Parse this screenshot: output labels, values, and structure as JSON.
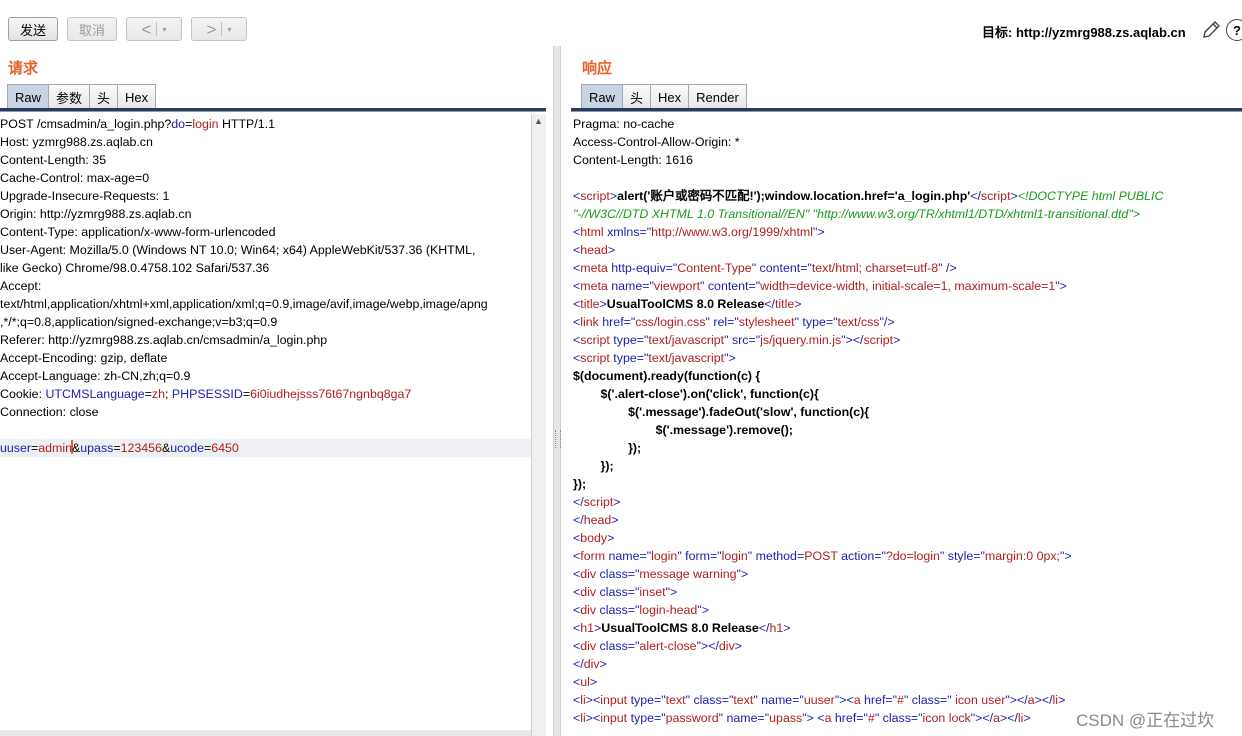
{
  "toolbar": {
    "send_label": "发送",
    "cancel_label": "取消",
    "back_glyph": "<",
    "forward_glyph": ">",
    "dropdown_glyph": "▾"
  },
  "target": {
    "text": "目标: http://yzmrg988.zs.aqlab.cn"
  },
  "icons": {
    "edit": "pencil-icon",
    "help": "help-icon",
    "help_glyph": "?"
  },
  "request": {
    "title": "请求",
    "tabs": [
      "Raw",
      "参数",
      "头",
      "Hex"
    ],
    "active_tab": "Raw",
    "lines": [
      [
        {
          "t": "POST /cmsadmin/a_login.php?"
        },
        {
          "t": "do",
          "c": "p"
        },
        {
          "t": "="
        },
        {
          "t": "login",
          "c": "v"
        },
        {
          "t": " HTTP/1.1"
        }
      ],
      [
        {
          "t": "Host: yzmrg988.zs.aqlab.cn"
        }
      ],
      [
        {
          "t": "Content-Length: 35"
        }
      ],
      [
        {
          "t": "Cache-Control: max-age=0"
        }
      ],
      [
        {
          "t": "Upgrade-Insecure-Requests: 1"
        }
      ],
      [
        {
          "t": "Origin: http://yzmrg988.zs.aqlab.cn"
        }
      ],
      [
        {
          "t": "Content-Type: application/x-www-form-urlencoded"
        }
      ],
      [
        {
          "t": "User-Agent: Mozilla/5.0 (Windows NT 10.0; Win64; x64) AppleWebKit/537.36 (KHTML,"
        }
      ],
      [
        {
          "t": "like Gecko) Chrome/98.0.4758.102 Safari/537.36"
        }
      ],
      [
        {
          "t": "Accept:"
        }
      ],
      [
        {
          "t": "text/html,application/xhtml+xml,application/xml;q=0.9,image/avif,image/webp,image/apng"
        }
      ],
      [
        {
          "t": ",*/*;q=0.8,application/signed-exchange;v=b3;q=0.9"
        }
      ],
      [
        {
          "t": "Referer: http://yzmrg988.zs.aqlab.cn/cmsadmin/a_login.php"
        }
      ],
      [
        {
          "t": "Accept-Encoding: gzip, deflate"
        }
      ],
      [
        {
          "t": "Accept-Language: zh-CN,zh;q=0.9"
        }
      ],
      [
        {
          "t": "Cookie: "
        },
        {
          "t": "UTCMSLanguage",
          "c": "p"
        },
        {
          "t": "="
        },
        {
          "t": "zh",
          "c": "v"
        },
        {
          "t": "; "
        },
        {
          "t": "PHPSESSID",
          "c": "p"
        },
        {
          "t": "="
        },
        {
          "t": "6i0iudhejsss76t67ngnbq8ga7",
          "c": "v"
        }
      ],
      [
        {
          "t": "Connection: close"
        }
      ],
      [
        {
          "t": ""
        }
      ],
      [
        {
          "t": "uuser",
          "c": "p"
        },
        {
          "t": "="
        },
        {
          "t": "admin",
          "c": "v"
        },
        {
          "caret": true
        },
        {
          "t": "&"
        },
        {
          "t": "upass",
          "c": "p"
        },
        {
          "t": "="
        },
        {
          "t": "123456",
          "c": "v"
        },
        {
          "t": "&"
        },
        {
          "t": "ucode",
          "c": "p"
        },
        {
          "t": "="
        },
        {
          "t": "6450",
          "c": "v"
        }
      ]
    ],
    "highlight_line": 18
  },
  "response": {
    "title": "响应",
    "tabs": [
      "Raw",
      "头",
      "Hex",
      "Render"
    ],
    "active_tab": "Raw",
    "lines": [
      [
        {
          "t": "Pragma: no-cache"
        }
      ],
      [
        {
          "t": "Access-Control-Allow-Origin: *"
        }
      ],
      [
        {
          "t": "Content-Length: 1616"
        }
      ],
      [
        {
          "t": ""
        }
      ],
      [
        {
          "t": "<",
          "c": "p"
        },
        {
          "t": "script",
          "c": "v"
        },
        {
          "t": ">",
          "c": "p"
        },
        {
          "t": "alert('账户或密码不匹配!');window.location.href='a_login.php'",
          "c": "b"
        },
        {
          "t": "</",
          "c": "p"
        },
        {
          "t": "script",
          "c": "v"
        },
        {
          "t": ">",
          "c": "p"
        },
        {
          "t": "<!DOCTYPE html PUBLIC",
          "c": "g"
        }
      ],
      [
        {
          "t": "\"-//W3C//DTD XHTML 1.0 Transitional//EN\" \"http://www.w3.org/TR/xhtml1/DTD/xhtml1-transitional.dtd\">",
          "c": "g"
        }
      ],
      [
        {
          "t": "<",
          "c": "p"
        },
        {
          "t": "html",
          "c": "v"
        },
        {
          "t": " xmlns",
          "c": "p"
        },
        {
          "t": "=\"",
          "c": "p"
        },
        {
          "t": "http://www.w3.org/1999/xhtml",
          "c": "v"
        },
        {
          "t": "\">",
          "c": "p"
        }
      ],
      [
        {
          "t": "<",
          "c": "p"
        },
        {
          "t": "head",
          "c": "v"
        },
        {
          "t": ">",
          "c": "p"
        }
      ],
      [
        {
          "t": "<",
          "c": "p"
        },
        {
          "t": "meta",
          "c": "v"
        },
        {
          "t": " http-equiv",
          "c": "p"
        },
        {
          "t": "=\"",
          "c": "p"
        },
        {
          "t": "Content-Type",
          "c": "v"
        },
        {
          "t": "\" content",
          "c": "p"
        },
        {
          "t": "=\"",
          "c": "p"
        },
        {
          "t": "text/html; charset=utf-8",
          "c": "v"
        },
        {
          "t": "\" />",
          "c": "p"
        }
      ],
      [
        {
          "t": "<",
          "c": "p"
        },
        {
          "t": "meta",
          "c": "v"
        },
        {
          "t": " name",
          "c": "p"
        },
        {
          "t": "=\"",
          "c": "p"
        },
        {
          "t": "viewport",
          "c": "v"
        },
        {
          "t": "\" content",
          "c": "p"
        },
        {
          "t": "=\"",
          "c": "p"
        },
        {
          "t": "width=device-width, initial-scale=1, maximum-scale=1",
          "c": "v"
        },
        {
          "t": "\">",
          "c": "p"
        }
      ],
      [
        {
          "t": "<",
          "c": "p"
        },
        {
          "t": "title",
          "c": "v"
        },
        {
          "t": ">",
          "c": "p"
        },
        {
          "t": "UsualToolCMS 8.0 Release",
          "c": "b"
        },
        {
          "t": "</",
          "c": "p"
        },
        {
          "t": "title",
          "c": "v"
        },
        {
          "t": ">",
          "c": "p"
        }
      ],
      [
        {
          "t": "<",
          "c": "p"
        },
        {
          "t": "link",
          "c": "v"
        },
        {
          "t": " href",
          "c": "p"
        },
        {
          "t": "=\"",
          "c": "p"
        },
        {
          "t": "css/login.css",
          "c": "v"
        },
        {
          "t": "\" rel",
          "c": "p"
        },
        {
          "t": "=\"",
          "c": "p"
        },
        {
          "t": "stylesheet",
          "c": "v"
        },
        {
          "t": "\" type",
          "c": "p"
        },
        {
          "t": "=\"",
          "c": "p"
        },
        {
          "t": "text/css",
          "c": "v"
        },
        {
          "t": "\"/>",
          "c": "p"
        }
      ],
      [
        {
          "t": "<",
          "c": "p"
        },
        {
          "t": "script",
          "c": "v"
        },
        {
          "t": " type",
          "c": "p"
        },
        {
          "t": "=\"",
          "c": "p"
        },
        {
          "t": "text/javascript",
          "c": "v"
        },
        {
          "t": "\" src",
          "c": "p"
        },
        {
          "t": "=\"",
          "c": "p"
        },
        {
          "t": "js/jquery.min.js",
          "c": "v"
        },
        {
          "t": "\"></",
          "c": "p"
        },
        {
          "t": "script",
          "c": "v"
        },
        {
          "t": ">",
          "c": "p"
        }
      ],
      [
        {
          "t": "<",
          "c": "p"
        },
        {
          "t": "script",
          "c": "v"
        },
        {
          "t": " type",
          "c": "p"
        },
        {
          "t": "=\"",
          "c": "p"
        },
        {
          "t": "text/javascript",
          "c": "v"
        },
        {
          "t": "\">",
          "c": "p"
        }
      ],
      [
        {
          "t": "$(document).ready(function(c) {",
          "c": "b"
        }
      ],
      [
        {
          "t": "        $('.alert-close').on('click', function(c){",
          "c": "b"
        }
      ],
      [
        {
          "t": "                $('.message').fadeOut('slow', function(c){",
          "c": "b"
        }
      ],
      [
        {
          "t": "                        $('.message').remove();",
          "c": "b"
        }
      ],
      [
        {
          "t": "                });",
          "c": "b"
        }
      ],
      [
        {
          "t": "        });",
          "c": "b"
        }
      ],
      [
        {
          "t": "});",
          "c": "b"
        }
      ],
      [
        {
          "t": "</",
          "c": "p"
        },
        {
          "t": "script",
          "c": "v"
        },
        {
          "t": ">",
          "c": "p"
        }
      ],
      [
        {
          "t": "</",
          "c": "p"
        },
        {
          "t": "head",
          "c": "v"
        },
        {
          "t": ">",
          "c": "p"
        }
      ],
      [
        {
          "t": "<",
          "c": "p"
        },
        {
          "t": "body",
          "c": "v"
        },
        {
          "t": ">",
          "c": "p"
        }
      ],
      [
        {
          "t": "<",
          "c": "p"
        },
        {
          "t": "form",
          "c": "v"
        },
        {
          "t": " name",
          "c": "p"
        },
        {
          "t": "=\"",
          "c": "p"
        },
        {
          "t": "login",
          "c": "v"
        },
        {
          "t": "\" form",
          "c": "p"
        },
        {
          "t": "=\"",
          "c": "p"
        },
        {
          "t": "login",
          "c": "v"
        },
        {
          "t": "\" method",
          "c": "p"
        },
        {
          "t": "=",
          "c": "p"
        },
        {
          "t": "POST",
          "c": "v"
        },
        {
          "t": " action",
          "c": "p"
        },
        {
          "t": "=\"",
          "c": "p"
        },
        {
          "t": "?do=login",
          "c": "v"
        },
        {
          "t": "\" style",
          "c": "p"
        },
        {
          "t": "=\"",
          "c": "p"
        },
        {
          "t": "margin:0 0px;",
          "c": "v"
        },
        {
          "t": "\">",
          "c": "p"
        }
      ],
      [
        {
          "t": "<",
          "c": "p"
        },
        {
          "t": "div",
          "c": "v"
        },
        {
          "t": " class",
          "c": "p"
        },
        {
          "t": "=\"",
          "c": "p"
        },
        {
          "t": "message warning",
          "c": "v"
        },
        {
          "t": "\">",
          "c": "p"
        }
      ],
      [
        {
          "t": "<",
          "c": "p"
        },
        {
          "t": "div",
          "c": "v"
        },
        {
          "t": " class",
          "c": "p"
        },
        {
          "t": "=\"",
          "c": "p"
        },
        {
          "t": "inset",
          "c": "v"
        },
        {
          "t": "\">",
          "c": "p"
        }
      ],
      [
        {
          "t": "<",
          "c": "p"
        },
        {
          "t": "div",
          "c": "v"
        },
        {
          "t": " class",
          "c": "p"
        },
        {
          "t": "=\"",
          "c": "p"
        },
        {
          "t": "login-head",
          "c": "v"
        },
        {
          "t": "\">",
          "c": "p"
        }
      ],
      [
        {
          "t": "<",
          "c": "p"
        },
        {
          "t": "h1",
          "c": "v"
        },
        {
          "t": ">",
          "c": "p"
        },
        {
          "t": "UsualToolCMS 8.0 Release",
          "c": "b"
        },
        {
          "t": "</",
          "c": "p"
        },
        {
          "t": "h1",
          "c": "v"
        },
        {
          "t": ">",
          "c": "p"
        }
      ],
      [
        {
          "t": "<",
          "c": "p"
        },
        {
          "t": "div",
          "c": "v"
        },
        {
          "t": " class",
          "c": "p"
        },
        {
          "t": "=\"",
          "c": "p"
        },
        {
          "t": "alert-close",
          "c": "v"
        },
        {
          "t": "\"></",
          "c": "p"
        },
        {
          "t": "div",
          "c": "v"
        },
        {
          "t": ">",
          "c": "p"
        }
      ],
      [
        {
          "t": "</",
          "c": "p"
        },
        {
          "t": "div",
          "c": "v"
        },
        {
          "t": ">",
          "c": "p"
        }
      ],
      [
        {
          "t": "<",
          "c": "p"
        },
        {
          "t": "ul",
          "c": "v"
        },
        {
          "t": ">",
          "c": "p"
        }
      ],
      [
        {
          "t": "<",
          "c": "p"
        },
        {
          "t": "li",
          "c": "v"
        },
        {
          "t": "><",
          "c": "p"
        },
        {
          "t": "input",
          "c": "v"
        },
        {
          "t": " type",
          "c": "p"
        },
        {
          "t": "=\"",
          "c": "p"
        },
        {
          "t": "text",
          "c": "v"
        },
        {
          "t": "\" class",
          "c": "p"
        },
        {
          "t": "=\"",
          "c": "p"
        },
        {
          "t": "text",
          "c": "v"
        },
        {
          "t": "\" name",
          "c": "p"
        },
        {
          "t": "=\"",
          "c": "p"
        },
        {
          "t": "uuser",
          "c": "v"
        },
        {
          "t": "\"><",
          "c": "p"
        },
        {
          "t": "a",
          "c": "v"
        },
        {
          "t": " href",
          "c": "p"
        },
        {
          "t": "=\"",
          "c": "p"
        },
        {
          "t": "#",
          "c": "v"
        },
        {
          "t": "\" class",
          "c": "p"
        },
        {
          "t": "=\"",
          "c": "p"
        },
        {
          "t": " icon user",
          "c": "v"
        },
        {
          "t": "\"></",
          "c": "p"
        },
        {
          "t": "a",
          "c": "v"
        },
        {
          "t": "></",
          "c": "p"
        },
        {
          "t": "li",
          "c": "v"
        },
        {
          "t": ">",
          "c": "p"
        }
      ],
      [
        {
          "t": "<",
          "c": "p"
        },
        {
          "t": "li",
          "c": "v"
        },
        {
          "t": "><",
          "c": "p"
        },
        {
          "t": "input",
          "c": "v"
        },
        {
          "t": " type",
          "c": "p"
        },
        {
          "t": "=\"",
          "c": "p"
        },
        {
          "t": "password",
          "c": "v"
        },
        {
          "t": "\" name",
          "c": "p"
        },
        {
          "t": "=\"",
          "c": "p"
        },
        {
          "t": "upass",
          "c": "v"
        },
        {
          "t": "\"> <",
          "c": "p"
        },
        {
          "t": "a",
          "c": "v"
        },
        {
          "t": " href",
          "c": "p"
        },
        {
          "t": "=\"",
          "c": "p"
        },
        {
          "t": "#",
          "c": "v"
        },
        {
          "t": "\" class",
          "c": "p"
        },
        {
          "t": "=\"",
          "c": "p"
        },
        {
          "t": "icon lock",
          "c": "v"
        },
        {
          "t": "\"></",
          "c": "p"
        },
        {
          "t": "a",
          "c": "v"
        },
        {
          "t": "></",
          "c": "p"
        },
        {
          "t": "li",
          "c": "v"
        },
        {
          "t": ">",
          "c": "p"
        }
      ]
    ]
  },
  "watermark": {
    "text": "CSDN @正在过坎"
  }
}
